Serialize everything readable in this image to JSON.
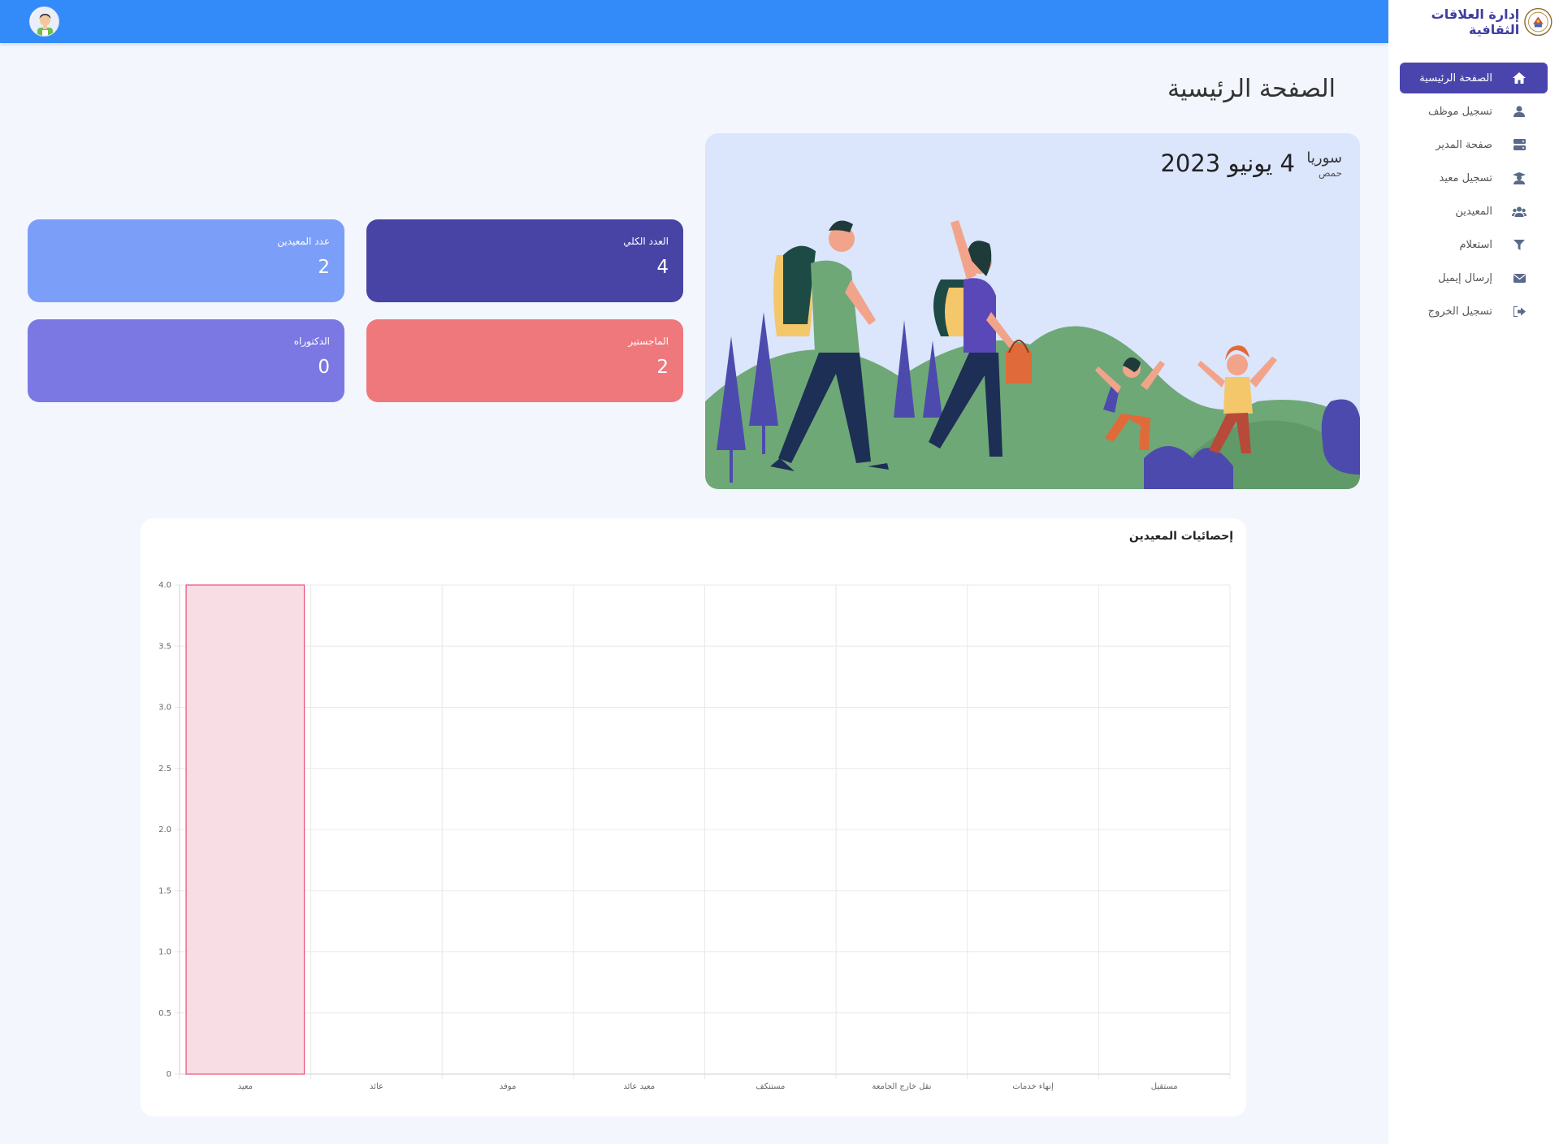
{
  "brand": {
    "title": "إدارة العلاقات الثقافية"
  },
  "sidebar": {
    "items": [
      {
        "label": "الصفحة الرئيسية",
        "icon": "home-icon",
        "active": true
      },
      {
        "label": "تسجيل موظف",
        "icon": "user-icon"
      },
      {
        "label": "صفحة المدير",
        "icon": "server-icon"
      },
      {
        "label": "تسجيل معيد",
        "icon": "graduate-icon"
      },
      {
        "label": "المعيدين",
        "icon": "users-icon"
      },
      {
        "label": "استعلام",
        "icon": "filter-icon"
      },
      {
        "label": "إرسال إيميل",
        "icon": "envelope-icon"
      },
      {
        "label": "تسجيل الخروج",
        "icon": "sign-out-icon"
      }
    ]
  },
  "page": {
    "title": "الصفحة الرئيسية"
  },
  "hero": {
    "date": "4 يونيو 2023",
    "country": "سوريا",
    "city": "حمص"
  },
  "cards": {
    "total": {
      "label": "العدد الكلي",
      "value": "4",
      "color": "#4744a5"
    },
    "demonstrators": {
      "label": "عدد المعيدين",
      "value": "2",
      "color": "#7b9ff9"
    },
    "master": {
      "label": "الماجستير",
      "value": "2",
      "color": "#ee787b"
    },
    "phd": {
      "label": "الدكتوراه",
      "value": "0",
      "color": "#7b78e4"
    }
  },
  "chart": {
    "title": "إحصائيات المعيدين"
  },
  "chart_data": {
    "type": "bar",
    "categories": [
      "معيد",
      "عائد",
      "موفد",
      "معيد عائد",
      "مستنكف",
      "نقل خارج الجامعة",
      "إنهاء خدمات",
      "مستقيل"
    ],
    "values": [
      4,
      0,
      0,
      0,
      0,
      0,
      0,
      0
    ],
    "ylim": [
      0,
      4
    ],
    "yticks": [
      "0",
      "0.5",
      "1.0",
      "1.5",
      "2.0",
      "2.5",
      "3.0",
      "3.5",
      "4.0"
    ],
    "grid": true,
    "bar_fill": "#f9dde4",
    "bar_stroke": "#e8507a"
  }
}
